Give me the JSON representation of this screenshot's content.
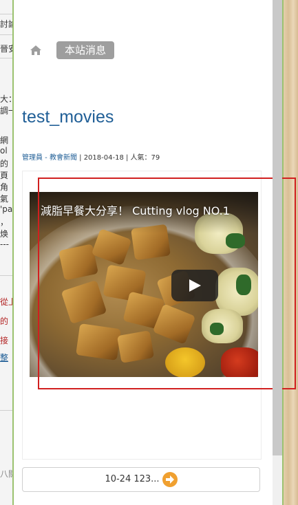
{
  "background_left": {
    "fragments": [
      "討論",
      "晉安",
      "大：",
      "調一",
      "網",
      "ol",
      "的",
      "頁",
      "角",
      "氣",
      "'pa",
      "，",
      "焕",
      "---",
      "從上",
      "的",
      "接",
      "整",
      "八關"
    ]
  },
  "breadcrumb": {
    "home_icon": "home-icon",
    "current": "本站消息"
  },
  "post": {
    "title": "test_movies",
    "author": "管理員 - 教會新聞",
    "meta": " | 2018-04-18 | 人氣：79"
  },
  "video": {
    "title": "減脂早餐大分享！ Cutting vlog NO.1",
    "play_icon": "play-icon"
  },
  "pagination": {
    "label": "10-24 123...",
    "arrow_icon": "next-arrow-icon"
  },
  "colors": {
    "title_blue": "#1f5e96",
    "pill_gray": "#9e9e9e",
    "highlight_red": "#d11f1f",
    "arrow_orange": "#f0a030"
  }
}
